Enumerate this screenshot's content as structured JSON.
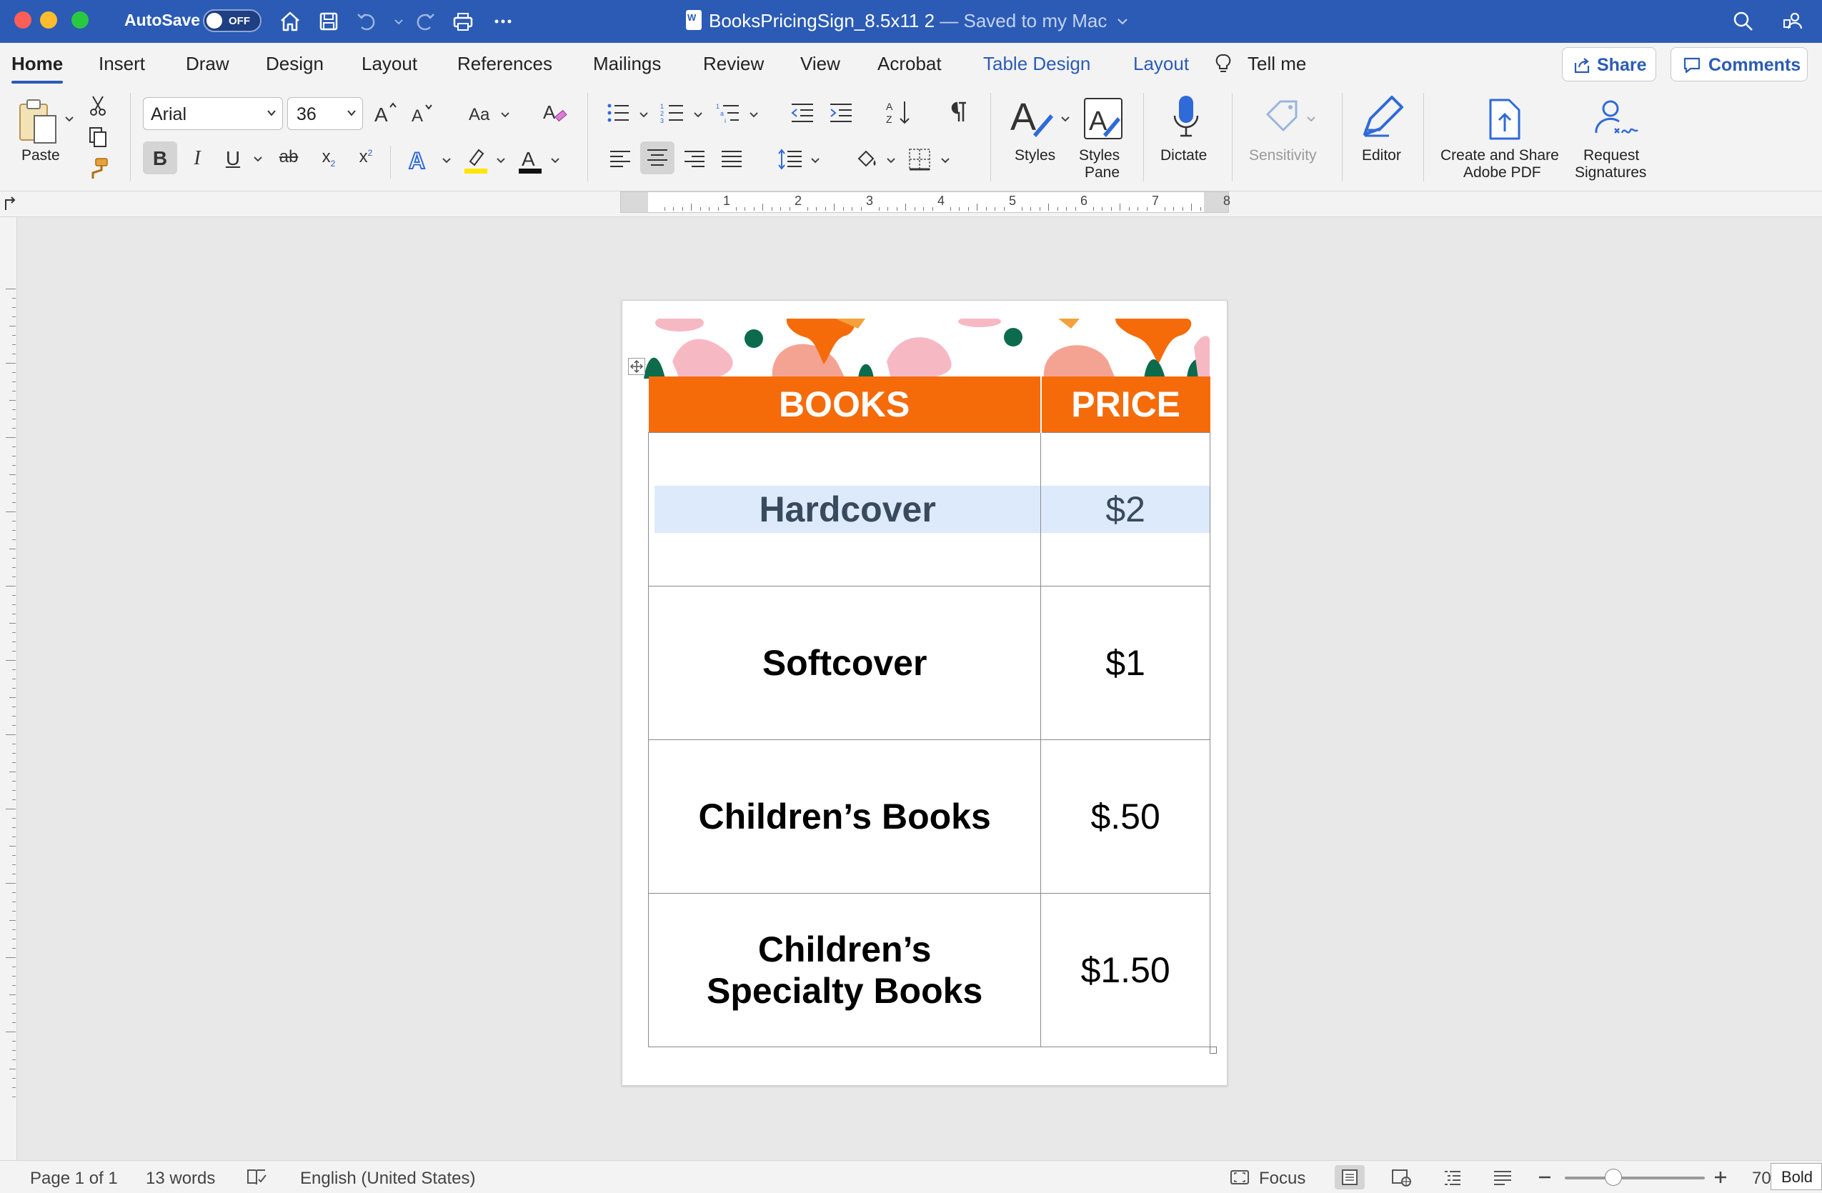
{
  "titlebar": {
    "autosave_label": "AutoSave",
    "autosave_state": "OFF",
    "doc_name": "BooksPricingSign_8.5x11 2",
    "save_status": " — Saved to my Mac",
    "accent": "#2b5bb5"
  },
  "tabs": {
    "home": "Home",
    "insert": "Insert",
    "draw": "Draw",
    "design": "Design",
    "layout": "Layout",
    "references": "References",
    "mailings": "Mailings",
    "review": "Review",
    "view": "View",
    "acrobat": "Acrobat",
    "table_design": "Table Design",
    "table_layout": "Layout",
    "tell_me": "Tell me",
    "share": "Share",
    "comments": "Comments"
  },
  "ribbon": {
    "paste": "Paste",
    "font_name": "Arial",
    "font_size": "36",
    "bold": "B",
    "italic": "I",
    "underline": "U",
    "strike": "ab",
    "subscript": "x",
    "superscript": "x",
    "styles": "Styles",
    "styles_pane_1": "Styles",
    "styles_pane_2": "Pane",
    "dictate": "Dictate",
    "sensitivity": "Sensitivity",
    "editor": "Editor",
    "adobe_1": "Create and Share",
    "adobe_2": "Adobe PDF",
    "signatures_1": "Request",
    "signatures_2": "Signatures"
  },
  "ruler": {
    "marks": [
      "1",
      "2",
      "3",
      "4",
      "5",
      "6",
      "7",
      "8"
    ]
  },
  "document": {
    "header": {
      "col1": "BOOKS",
      "col2": "PRICE"
    },
    "rows": [
      {
        "name": "Hardcover",
        "price": "$2"
      },
      {
        "name": "Softcover",
        "price": "$1"
      },
      {
        "name": "Children’s Books",
        "price": "$.50"
      },
      {
        "name": "Children’s Specialty Books",
        "price": "$1.50"
      }
    ],
    "header_color": "#f56b0a"
  },
  "status": {
    "page": "Page 1 of 1",
    "words": "13 words",
    "language": "English (United States)",
    "focus": "Focus",
    "zoom": "70",
    "tooltip": "Bold"
  }
}
